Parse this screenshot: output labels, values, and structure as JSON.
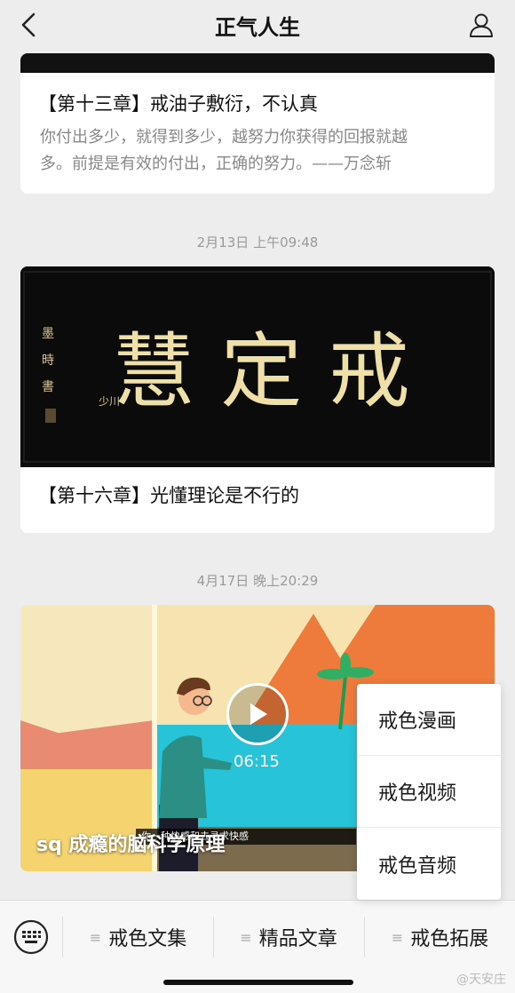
{
  "header": {
    "title": "正气人生"
  },
  "articles": [
    {
      "title": "【第十三章】戒油子敷衍，不认真",
      "desc_line1": "你付出多少，就得到多少，越努力你获得的回报就越",
      "desc_line2": "多。前提是有效的付出，正确的努力。——万念斩"
    },
    {
      "timestamp": "2月13日 上午09:48",
      "banner_text": "慧 定 戒",
      "title": "【第十六章】光懂理论是不行的"
    },
    {
      "timestamp": "4月17日 晚上20:29",
      "video_title": "sq 成瘾的脑科学原理",
      "duration": "06:15",
      "subtitle": "你一种快感和去寻求快感"
    }
  ],
  "popup_menu": {
    "items": [
      "戒色漫画",
      "戒色视频",
      "戒色音频"
    ]
  },
  "bottom_menu": {
    "items": [
      "戒色文集",
      "精品文章",
      "戒色拓展"
    ]
  },
  "watermark": "@天安庄"
}
